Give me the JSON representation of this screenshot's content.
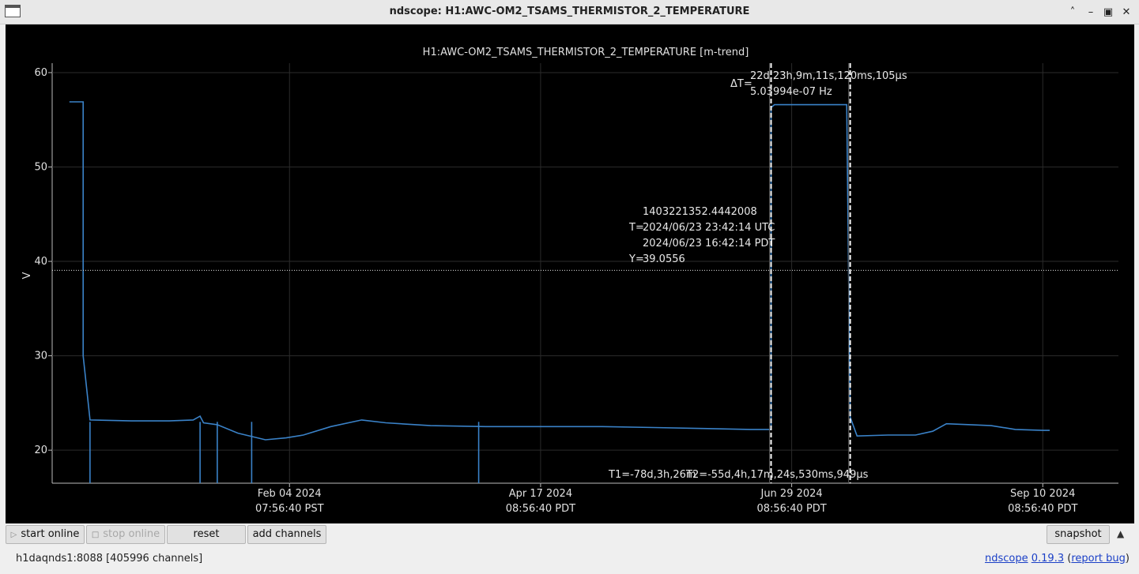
{
  "window": {
    "title": "ndscope: H1:AWC-OM2_TSAMS_THERMISTOR_2_TEMPERATURE",
    "controls": [
      "minimize",
      "maximize",
      "restore",
      "close"
    ]
  },
  "plot": {
    "title": "H1:AWC-OM2_TSAMS_THERMISTOR_2_TEMPERATURE [m-trend]",
    "ylabel": "V",
    "crosshair": {
      "gps": "1403221352.4442008",
      "t_label": "T=",
      "utc": "2024/06/23 23:42:14 UTC",
      "local": "2024/06/23 16:42:14 PDT",
      "y_label": "Y=",
      "y_value": "39.0556"
    },
    "delta": {
      "label": "ΔT=",
      "time": "22d,23h,9m,11s,120ms,105μs",
      "freq": "5.03994e-07 Hz"
    },
    "t1": "T1=-78d,3h,26m",
    "t2": "T2=-55d,4h,17m,24s,530ms,949μs"
  },
  "chart_data": {
    "type": "line",
    "title": "H1:AWC-OM2_TSAMS_THERMISTOR_2_TEMPERATURE [m-trend]",
    "ylabel": "V",
    "xlabel": "",
    "ylim": [
      16.5,
      61
    ],
    "grid": true,
    "yticks": [
      20,
      30,
      40,
      50,
      60
    ],
    "xticks": [
      {
        "date": "Feb 04 2024",
        "time": "07:56:40 PST"
      },
      {
        "date": "Apr 17 2024",
        "time": "08:56:40 PDT"
      },
      {
        "date": "Jun 29 2024",
        "time": "08:56:40 PDT"
      },
      {
        "date": "Sep 10 2024",
        "time": "08:56:40 PDT"
      }
    ],
    "series": [
      {
        "color": "#3a82c8",
        "x": [
          "2023-12-02",
          "2023-12-06",
          "2023-12-06",
          "2023-12-08",
          "2023-12-20",
          "2023-12-31",
          "2024-01-07",
          "2024-01-09",
          "2024-01-10",
          "2024-01-14",
          "2024-01-20",
          "2024-01-28",
          "2024-02-03",
          "2024-02-08",
          "2024-02-16",
          "2024-02-25",
          "2024-03-03",
          "2024-03-16",
          "2024-04-01",
          "2024-04-17",
          "2024-05-05",
          "2024-05-20",
          "2024-06-03",
          "2024-06-17",
          "2024-06-23",
          "2024-06-23",
          "2024-06-24",
          "2024-07-01",
          "2024-07-10",
          "2024-07-15",
          "2024-07-16",
          "2024-07-18",
          "2024-07-27",
          "2024-08-04",
          "2024-08-09",
          "2024-08-13",
          "2024-08-20",
          "2024-08-26",
          "2024-09-02",
          "2024-09-10",
          "2024-09-12"
        ],
        "values": [
          56.9,
          56.9,
          30,
          23.2,
          23.1,
          23.1,
          23.2,
          23.6,
          22.9,
          22.7,
          21.8,
          21.1,
          21.3,
          21.6,
          22.5,
          23.2,
          22.9,
          22.6,
          22.5,
          22.5,
          22.5,
          22.4,
          22.3,
          22.2,
          22.2,
          56.3,
          56.6,
          56.6,
          56.6,
          56.6,
          23.5,
          21.5,
          21.6,
          21.6,
          22.0,
          22.8,
          22.7,
          22.6,
          22.2,
          22.1,
          22.1
        ]
      }
    ],
    "dropouts": [
      "2023-12-08",
      "2024-01-09",
      "2024-01-14",
      "2024-01-24",
      "2024-03-30"
    ],
    "cursors": {
      "horizontal_y": 39.0556,
      "t1": "2024-06-23",
      "t2": "2024-07-16"
    }
  },
  "toolbar": {
    "start_online": "start online",
    "stop_online": "stop online",
    "reset": "reset",
    "add_channels": "add channels",
    "snapshot": "snapshot"
  },
  "status": {
    "server": "h1daqnds1:8088  [405996 channels]",
    "app_name": "ndscope",
    "version": "0.19.3",
    "report_bug": "report bug"
  }
}
